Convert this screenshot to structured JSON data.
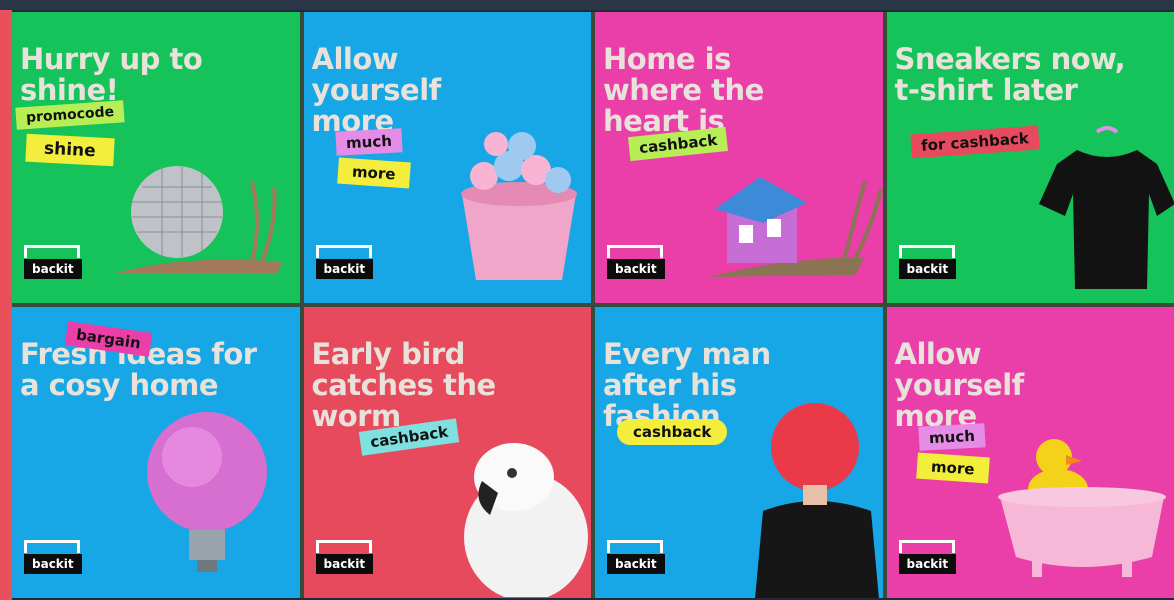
{
  "brand": "backit",
  "colors": {
    "green": "#15c35a",
    "blue": "#17a7e6",
    "pink": "#ea3fa8",
    "red": "#e84a5d",
    "lime_sticker": "#b8ee55",
    "yellow_sticker": "#f2ee3b",
    "pink_sticker": "#e58de6",
    "red_sticker": "#e84a5d",
    "cyan_sticker": "#7fe0e0"
  },
  "posters": [
    {
      "headline": "Hurry up to shine!",
      "stickers": [
        "promocode",
        "shine"
      ],
      "badge": "backit",
      "art": "disco-ball-snail"
    },
    {
      "headline": "Allow yourself more",
      "stickers": [
        "much",
        "more"
      ],
      "badge": "backit",
      "art": "donut-bucket"
    },
    {
      "headline": "Home is where the heart is",
      "stickers": [
        "cashback"
      ],
      "badge": "backit",
      "art": "house-snail"
    },
    {
      "headline": "Sneakers now, t-shirt later",
      "stickers": [
        "for cashback"
      ],
      "badge": "backit",
      "art": "black-tshirt"
    },
    {
      "headline": "Fresh ideas for a cosy home",
      "stickers": [
        "bargain"
      ],
      "badge": "backit",
      "art": "fluffy-lightbulb"
    },
    {
      "headline": "Early bird catches the worm",
      "stickers": [
        "cashback"
      ],
      "badge": "backit",
      "art": "white-cockatoo"
    },
    {
      "headline": "Every man after his fashion",
      "stickers": [
        "cashback"
      ],
      "badge": "backit",
      "art": "red-wig-woman"
    },
    {
      "headline": "Allow yourself more",
      "stickers": [
        "much",
        "more"
      ],
      "badge": "backit",
      "art": "rubber-duck-bathtub"
    }
  ]
}
